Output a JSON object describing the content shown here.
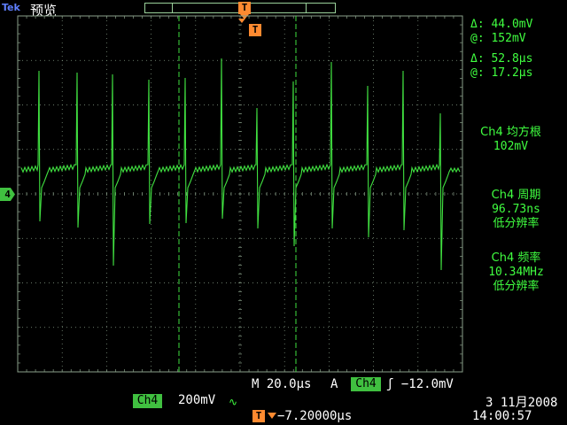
{
  "header": {
    "brand": "Tek",
    "mode": "预览",
    "trigger_position_icon": "trigger-position-icon",
    "trigger_marker_label": "T"
  },
  "channel_marker": {
    "label": "4",
    "icon": "channel-4-marker-icon"
  },
  "cursors": {
    "voltage_delta_symbol": "Δ:",
    "voltage_delta": "44.0mV",
    "voltage_at_symbol": "@:",
    "voltage_at": "152mV",
    "time_delta_symbol": "Δ:",
    "time_delta": "52.8μs",
    "time_at_symbol": "@:",
    "time_at": "17.2μs"
  },
  "measurements": [
    {
      "title": "Ch4 均方根",
      "value": "102mV",
      "note": ""
    },
    {
      "title": "Ch4 周期",
      "value": "96.73ns",
      "note": "低分辨率"
    },
    {
      "title": "Ch4 频率",
      "value": "10.34MHz",
      "note": "低分辨率"
    }
  ],
  "status": {
    "horizontal": "M 20.0μs",
    "acq_label": "A",
    "trigger_channel": "Ch4",
    "trigger_slope_level": "ʃ −12.0mV",
    "channel_label": "Ch4",
    "channel_scale": "200mV",
    "bw_icon": "∿",
    "position_value": "−7.20000μs",
    "date": "3 11月2008",
    "time": "14:00:57"
  },
  "colors": {
    "trace": "#40e040",
    "grid": "#8aa08a",
    "trigger": "#ff8a30",
    "channel": "#40c040"
  }
}
